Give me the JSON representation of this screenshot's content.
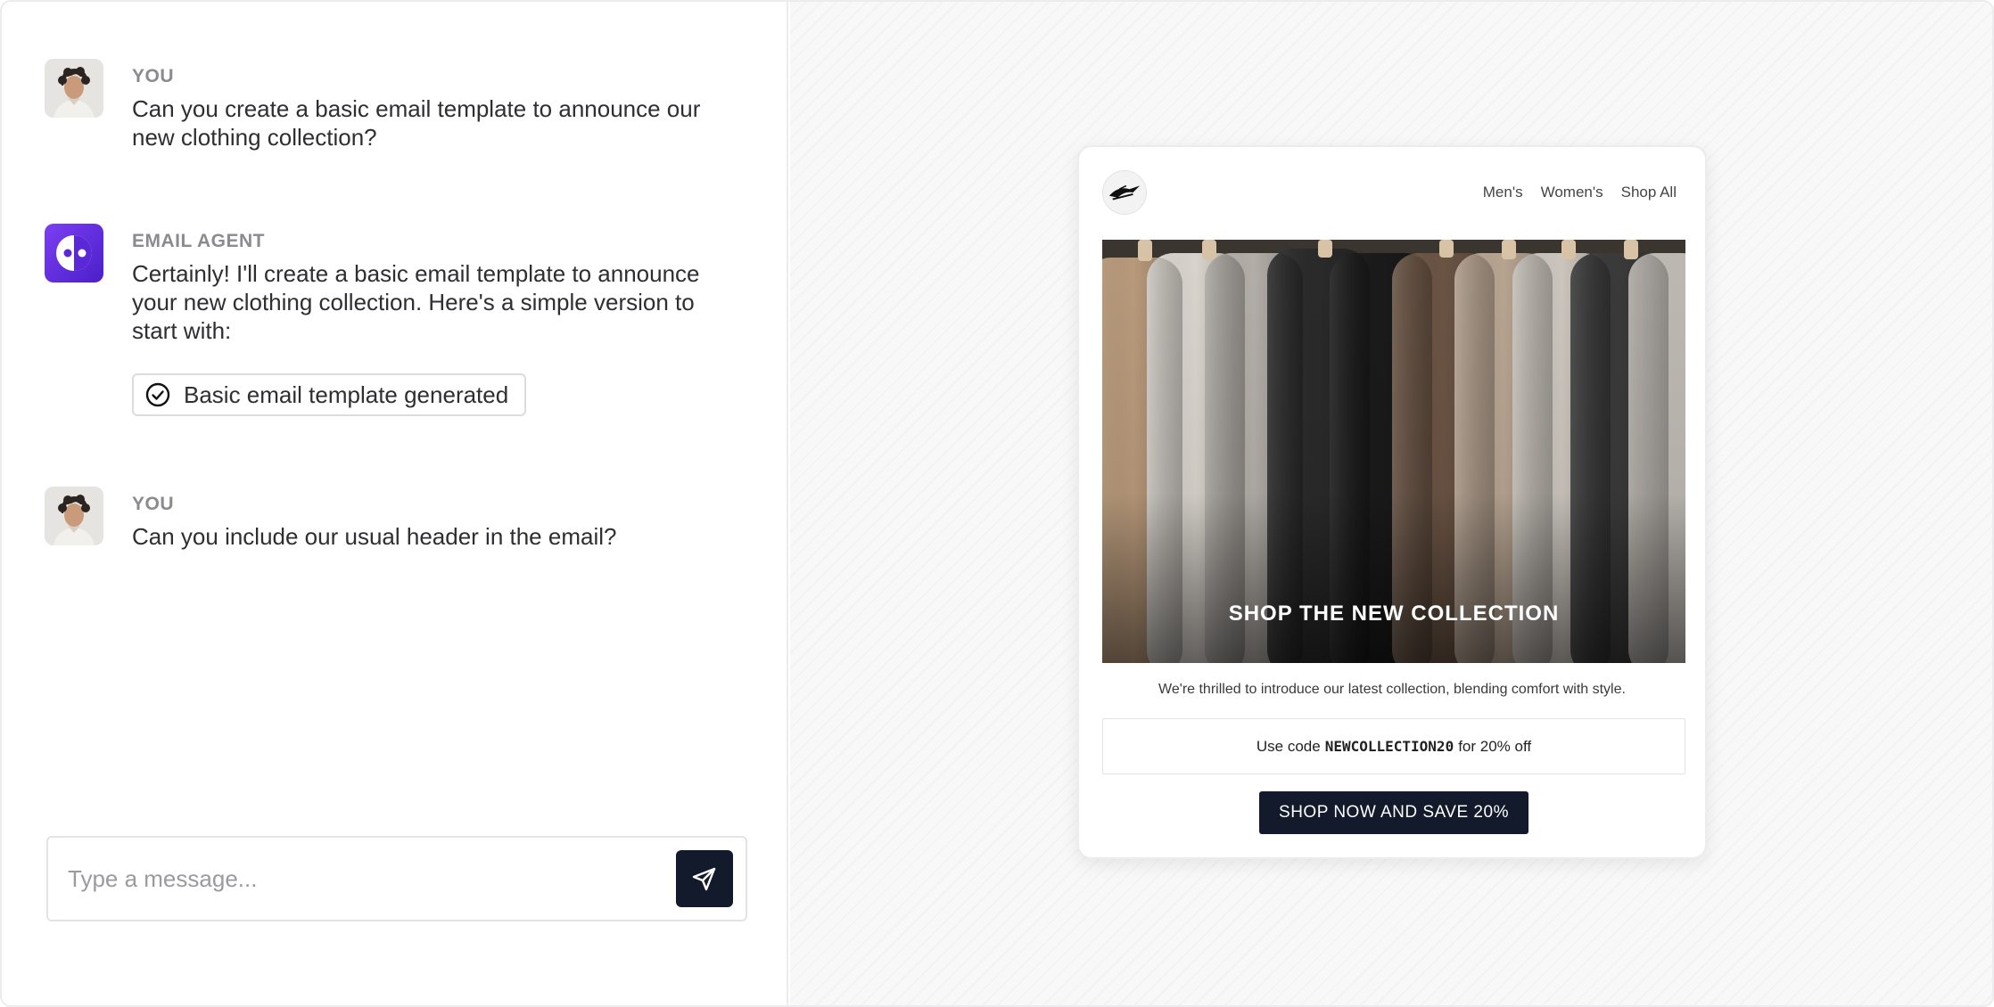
{
  "chat": {
    "messages": [
      {
        "sender": "YOU",
        "text": "Can you create a basic email template to announce our new clothing collection?"
      },
      {
        "sender": "EMAIL AGENT",
        "text": "Certainly! I'll create a basic email template to announce your new clothing collection. Here's a simple version to start with:",
        "status": "Basic email template generated"
      },
      {
        "sender": "YOU",
        "text": "Can you include our usual header in the email?"
      }
    ],
    "composer": {
      "placeholder": "Type a message..."
    }
  },
  "email": {
    "nav": [
      "Men's",
      "Women's",
      "Shop All"
    ],
    "hero_title": "SHOP THE NEW COLLECTION",
    "intro": "We're thrilled to introduce our latest collection, blending comfort with style.",
    "promo": {
      "before": "Use code",
      "code": "NEWCOLLECTION20",
      "after": "for 20% off"
    },
    "cta": "SHOP NOW AND SAVE 20%"
  },
  "colors": {
    "accent_dark": "#131a2b",
    "agent_gradient_start": "#7b3ff2",
    "agent_gradient_end": "#4a1fc9"
  },
  "icons": [
    "user-avatar",
    "email-agent-logo",
    "check-circle-icon",
    "send-icon",
    "brand-logo-icon"
  ]
}
